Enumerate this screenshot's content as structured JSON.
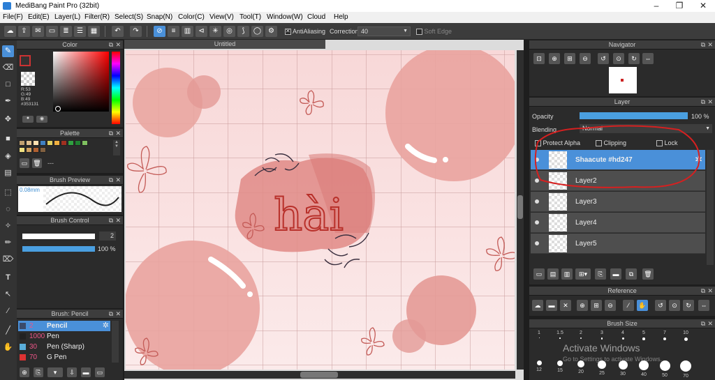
{
  "app": {
    "title": "MediBang Paint Pro (32bit)"
  },
  "menu": [
    "File(F)",
    "Edit(E)",
    "Layer(L)",
    "Filter(R)",
    "Select(S)",
    "Snap(N)",
    "Color(C)",
    "View(V)",
    "Tool(T)",
    "Window(W)",
    "Cloud",
    "Help"
  ],
  "toolbar": {
    "antialiasing": "AntiAliasing",
    "correction_label": "Correction",
    "correction_value": "40",
    "soft_edge": "Soft Edge"
  },
  "color_panel": {
    "title": "Color",
    "readout": [
      "R:53",
      "G:49",
      "B:49",
      "#353131"
    ],
    "fg_color": "#353131",
    "bg_color": "#ffffff"
  },
  "palette_panel": {
    "title": "Palette",
    "swatches": [
      "#c0a070",
      "#e0c090",
      "#ffe0b0",
      "#4080c0",
      "#e0d060",
      "#f0b040",
      "#a03020",
      "#30a040",
      "#208030",
      "#80c060",
      "#f0e080",
      "#d0a060",
      "#b06030",
      "#806040"
    ],
    "page_label": "---"
  },
  "brush_preview": {
    "title": "Brush Preview",
    "size_label": "0.08mm"
  },
  "brush_control": {
    "title": "Brush Control",
    "size_value": "2",
    "opacity_value": "100 %"
  },
  "brush_list": {
    "title": "Brush: Pencil",
    "items": [
      {
        "size": "2",
        "name": "Pencil",
        "color": "#3a4a6a"
      },
      {
        "size": "1000",
        "name": "Pen",
        "color": "#222222"
      },
      {
        "size": "30",
        "name": "Pen (Sharp)",
        "color": "#5aaeda"
      },
      {
        "size": "70",
        "name": "G Pen",
        "color": "#dd3333"
      }
    ]
  },
  "canvas": {
    "doc_title": "Untitled",
    "text": "hài"
  },
  "navigator": {
    "title": "Navigator"
  },
  "layer_panel": {
    "title": "Layer",
    "opacity_label": "Opacity",
    "opacity_value": "100 %",
    "blending_label": "Blending",
    "blending_value": "Normal",
    "protect_alpha": "Protect Alpha",
    "clipping": "Clipping",
    "lock": "Lock",
    "layers": [
      "Shaacute #hd247",
      "Layer2",
      "Layer3",
      "Layer4",
      "Layer5"
    ]
  },
  "reference": {
    "title": "Reference"
  },
  "brush_size": {
    "title": "Brush Size",
    "labels_top": [
      "1",
      "1.5",
      "2",
      "3",
      "4",
      "5",
      "7",
      "10"
    ],
    "labels_bottom": [
      "12",
      "15",
      "20",
      "25",
      "30",
      "40",
      "50",
      "70"
    ],
    "watermark": "Activate Windows",
    "watermark_sub": "Go to Settings to activate Windows."
  }
}
